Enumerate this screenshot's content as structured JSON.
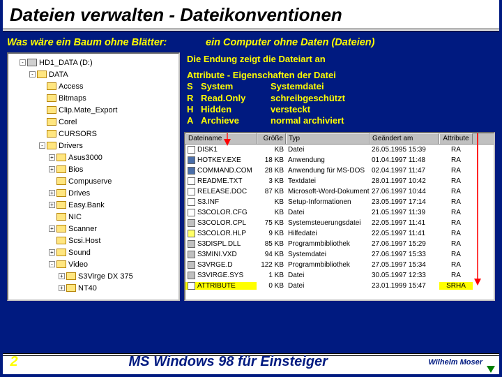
{
  "title": "Dateien verwalten - Dateikonventionen",
  "subtitle_left": "Was wäre ein Baum ohne Blätter:",
  "subtitle_right": "ein Computer ohne Daten (Dateien)",
  "info_line": "Die Endung zeigt die Dateiart an",
  "attr_header": "Attribute - Eigenschaften der Datei",
  "attrs": [
    {
      "k": "S",
      "n": "System",
      "d": "Systemdatei"
    },
    {
      "k": "R",
      "n": "Read.Only",
      "d": "schreibgeschützt"
    },
    {
      "k": "H",
      "n": "Hidden",
      "d": "versteckt"
    },
    {
      "k": "A",
      "n": "Archieve",
      "d": "normal archiviert"
    }
  ],
  "tree": {
    "root": "HD1_DATA (D:)",
    "data": "DATA",
    "items": [
      "Access",
      "Bitmaps",
      "Clip.Mate_Export",
      "Corel",
      "CURSORS"
    ],
    "drivers": "Drivers",
    "driver_items": [
      "Asus3000",
      "Bios",
      "Compuserve",
      "Drives",
      "Easy.Bank",
      "NIC",
      "Scanner",
      "Scsi.Host",
      "Sound",
      "Video"
    ],
    "video_items": [
      "S3Virge DX 375",
      "NT40"
    ]
  },
  "file_headers": {
    "name": "Dateiname",
    "size": "Größe",
    "type": "Typ",
    "date": "Geändert am",
    "attr": "Attribute"
  },
  "files": [
    {
      "name": "DISK1",
      "size": "KB",
      "type": "Datei",
      "date": "26.05.1995 15:39",
      "attr": "RA",
      "ico": "txt"
    },
    {
      "name": "HOTKEY.EXE",
      "size": "18 KB",
      "type": "Anwendung",
      "date": "01.04.1997 11:48",
      "attr": "RA",
      "ico": "exe"
    },
    {
      "name": "COMMAND.COM",
      "size": "28 KB",
      "type": "Anwendung für MS-DOS",
      "date": "02.04.1997 11:47",
      "attr": "RA",
      "ico": "exe"
    },
    {
      "name": "README.TXT",
      "size": "3 KB",
      "type": "Textdatei",
      "date": "28.01.1997 10:42",
      "attr": "RA",
      "ico": "txt"
    },
    {
      "name": "RELEASE.DOC",
      "size": "87 KB",
      "type": "Microsoft-Word-Dokument",
      "date": "27.06.1997 10:44",
      "attr": "RA",
      "ico": "txt"
    },
    {
      "name": "S3.INF",
      "size": "KB",
      "type": "Setup-Informationen",
      "date": "23.05.1997 17:14",
      "attr": "RA",
      "ico": "txt"
    },
    {
      "name": "S3COLOR.CFG",
      "size": "KB",
      "type": "Datei",
      "date": "21.05.1997 11:39",
      "attr": "RA",
      "ico": "txt"
    },
    {
      "name": "S3COLOR.CPL",
      "size": "75 KB",
      "type": "Systemsteuerungsdatei",
      "date": "22.05.1997 11:41",
      "attr": "RA",
      "ico": "sys"
    },
    {
      "name": "S3COLOR.HLP",
      "size": "9 KB",
      "type": "Hilfedatei",
      "date": "22.05.1997 11:41",
      "attr": "RA",
      "ico": "hlp"
    },
    {
      "name": "S3DISPL.DLL",
      "size": "85 KB",
      "type": "Programmbibliothek",
      "date": "27.06.1997 15:29",
      "attr": "RA",
      "ico": "sys"
    },
    {
      "name": "S3MINI.VXD",
      "size": "94 KB",
      "type": "Systemdatei",
      "date": "27.06.1997 15:33",
      "attr": "RA",
      "ico": "sys"
    },
    {
      "name": "S3VRGE.D",
      "size": "122 KB",
      "type": "Programmbibliothek",
      "date": "27.05.1997 15:34",
      "attr": "RA",
      "ico": "sys"
    },
    {
      "name": "S3VIRGE.SYS",
      "size": "1 KB",
      "type": "Datei",
      "date": "30.05.1997 12:33",
      "attr": "RA",
      "ico": "sys"
    },
    {
      "name": "ATTRIBUTE",
      "size": "0 KB",
      "type": "Datei",
      "date": "23.01.1999 15:47",
      "attr": "SRHA",
      "ico": "txt",
      "sel": true
    }
  ],
  "footer": {
    "num": "2",
    "title": "MS Windows 98 für Einsteiger",
    "author": "Wilhelm Moser"
  }
}
